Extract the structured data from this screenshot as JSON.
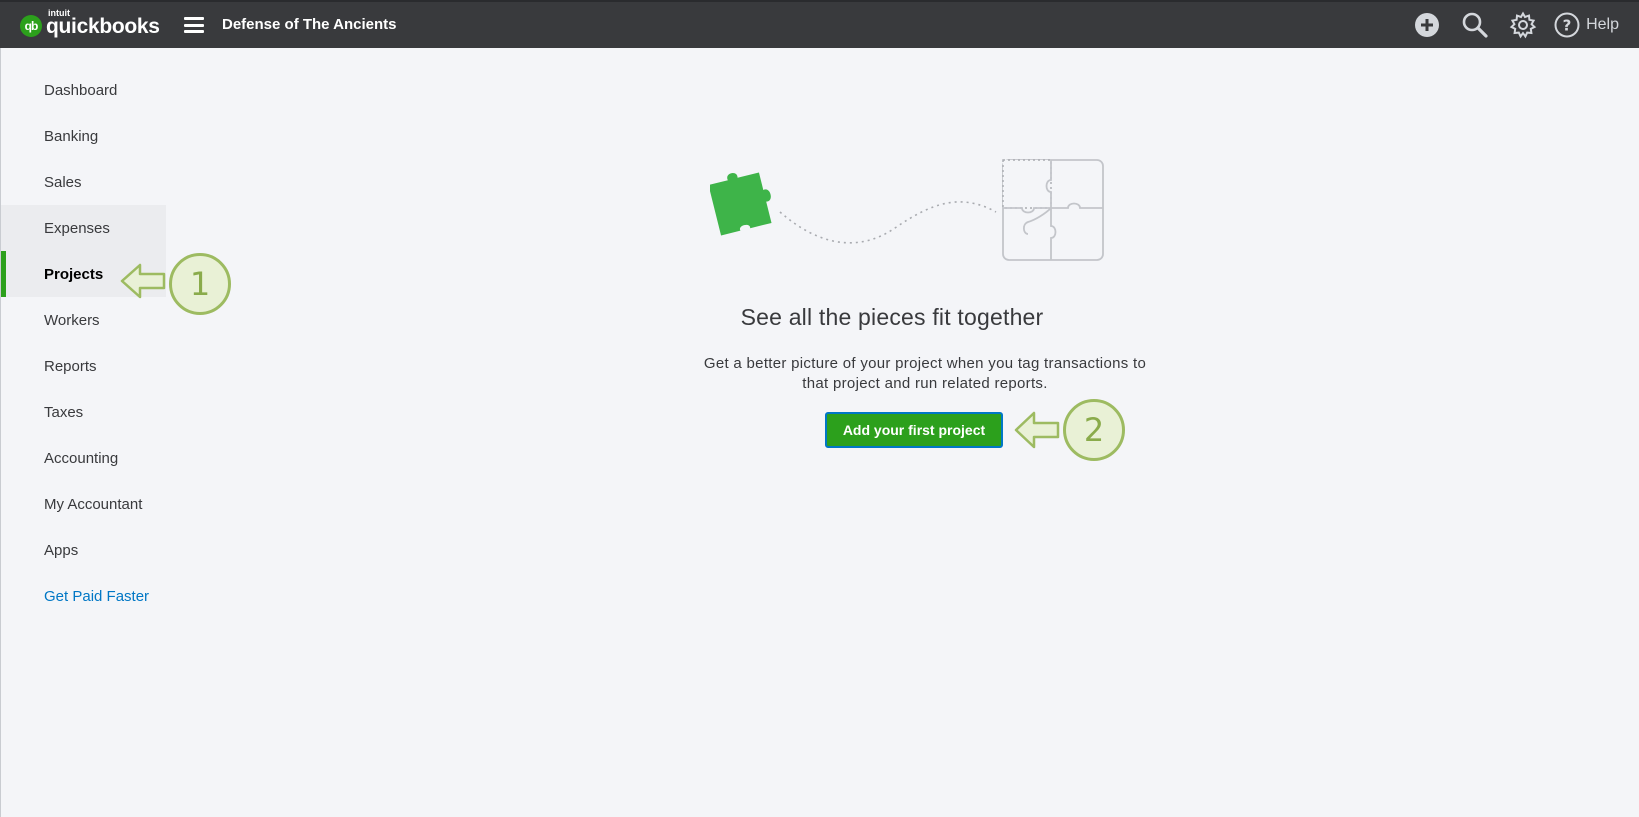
{
  "header": {
    "logo_small": "intuit",
    "logo_name": "quickbooks",
    "logo_badge": "qb",
    "company_name": "Defense of The Ancients",
    "help_label": "Help",
    "icons": [
      "plus-circle-icon",
      "search-icon",
      "gear-icon",
      "help-icon"
    ]
  },
  "sidebar": {
    "items": [
      {
        "label": "Dashboard"
      },
      {
        "label": "Banking"
      },
      {
        "label": "Sales"
      },
      {
        "label": "Expenses"
      },
      {
        "label": "Projects"
      },
      {
        "label": "Workers"
      },
      {
        "label": "Reports"
      },
      {
        "label": "Taxes"
      },
      {
        "label": "Accounting"
      },
      {
        "label": "My Accountant"
      },
      {
        "label": "Apps"
      },
      {
        "label": "Get Paid Faster"
      }
    ],
    "active_item": "Projects"
  },
  "main": {
    "headline": "See all the pieces fit together",
    "description": "Get a better picture of your project when you tag transactions to that project and run related reports.",
    "cta_label": "Add your first project"
  },
  "callouts": [
    {
      "number": "1"
    },
    {
      "number": "2"
    }
  ],
  "colors": {
    "topbar": "#393a3d",
    "brand_green": "#2ca01c",
    "link_blue": "#0077c5",
    "callout_green": "#9dbb61"
  }
}
